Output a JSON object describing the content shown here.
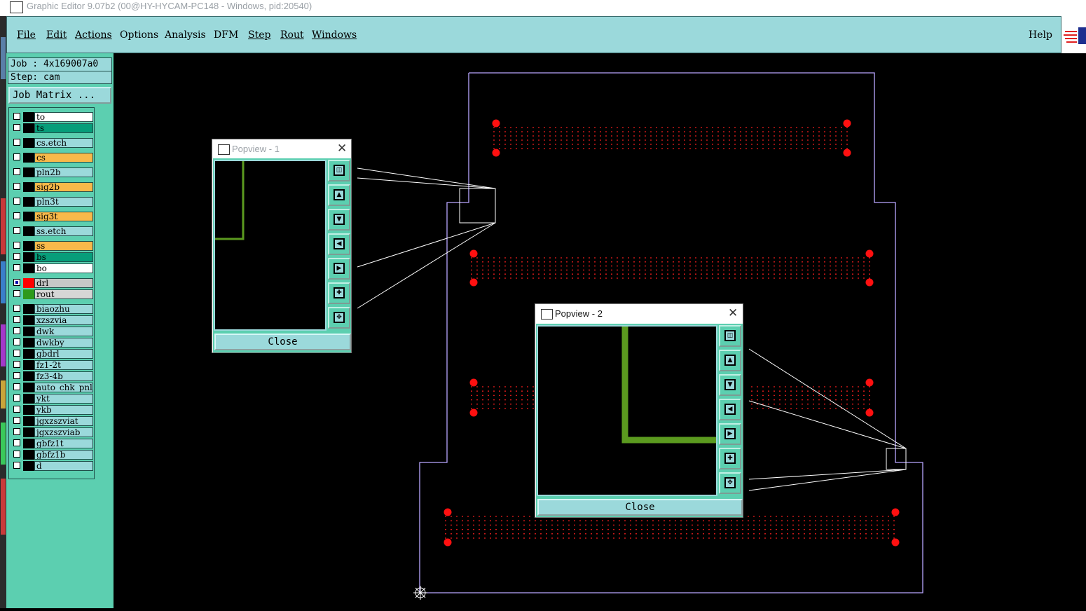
{
  "window": {
    "title": "Graphic Editor 9.07b2 (00@HY-HYCAM-PC148 - Windows, pid:20540)"
  },
  "menu": {
    "items": [
      {
        "label": "File"
      },
      {
        "label": "Edit"
      },
      {
        "label": "Actions"
      },
      {
        "label": "Options"
      },
      {
        "label": "Analysis"
      },
      {
        "label": "DFM"
      },
      {
        "label": "Step"
      },
      {
        "label": "Rout"
      },
      {
        "label": "Windows"
      }
    ],
    "help": "Help"
  },
  "job": {
    "job_line": "Job : 4x169007a0",
    "step_line": "Step: cam",
    "matrix_button": "Job Matrix ..."
  },
  "layers": [
    {
      "name": "to",
      "color": "#ffffff"
    },
    {
      "name": "ts",
      "color": "#079d7a"
    },
    {
      "name": "cs.etch",
      "color": "#9bd9db"
    },
    {
      "name": "cs",
      "color": "#f8b94a"
    },
    {
      "name": "pln2b",
      "color": "#9bd9db"
    },
    {
      "name": "sig2b",
      "color": "#f8b94a"
    },
    {
      "name": "pln3t",
      "color": "#9bd9db"
    },
    {
      "name": "sig3t",
      "color": "#f8b94a"
    },
    {
      "name": "ss.etch",
      "color": "#9bd9db"
    },
    {
      "name": "ss",
      "color": "#f8b94a"
    },
    {
      "name": "bs",
      "color": "#079d7a"
    },
    {
      "name": "bo",
      "color": "#ffffff"
    },
    {
      "name": "drl",
      "color": "#c7c7c7",
      "swatch": "#ff0000",
      "on": true
    },
    {
      "name": "rout",
      "color": "#d6d6d6",
      "swatch": "#2e9a1b"
    },
    {
      "name": "biaozhu",
      "color": "#9bd9db"
    },
    {
      "name": "xzszvia",
      "color": "#9bd9db"
    },
    {
      "name": "dwk",
      "color": "#9bd9db"
    },
    {
      "name": "dwkby",
      "color": "#9bd9db"
    },
    {
      "name": "gbdrl",
      "color": "#9bd9db"
    },
    {
      "name": "fz1-2t",
      "color": "#9bd9db"
    },
    {
      "name": "fz3-4b",
      "color": "#9bd9db"
    },
    {
      "name": "auto_chk_pnl",
      "color": "#9bd9db"
    },
    {
      "name": "ykt",
      "color": "#9bd9db"
    },
    {
      "name": "ykb",
      "color": "#9bd9db"
    },
    {
      "name": "jgxzszviat",
      "color": "#9bd9db"
    },
    {
      "name": "jgxzszviab",
      "color": "#9bd9db"
    },
    {
      "name": "gbfz1t",
      "color": "#9bd9db"
    },
    {
      "name": "gbfz1b",
      "color": "#9bd9db"
    },
    {
      "name": "d",
      "color": "#9bd9db"
    }
  ],
  "popview1": {
    "title": "Popview - 1",
    "close_label": "Close"
  },
  "popview2": {
    "title": "Popview - 2",
    "close_label": "Close"
  },
  "colors": {
    "menu_bg": "#9bd9db",
    "panel_bg": "#5ccfb0",
    "board_outline": "#b9a6ff",
    "drill": "#ff0000",
    "rout": "#5b9a1f"
  }
}
